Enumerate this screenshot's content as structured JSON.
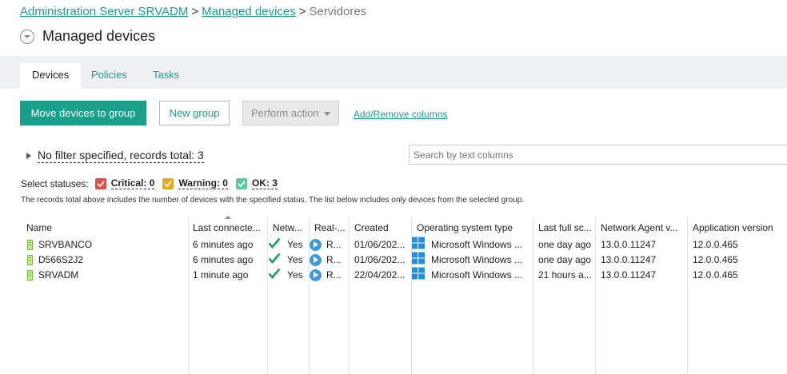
{
  "breadcrumb": {
    "server": "Administration Server SRVADM",
    "managed": "Managed devices",
    "current": "Servidores",
    "sep": ">"
  },
  "page": {
    "title": "Managed devices"
  },
  "tabs": [
    {
      "label": "Devices",
      "active": true
    },
    {
      "label": "Policies",
      "active": false
    },
    {
      "label": "Tasks",
      "active": false
    }
  ],
  "toolbar": {
    "move_label": "Move devices to group",
    "new_group_label": "New group",
    "perform_action_label": "Perform action",
    "add_remove_label": "Add/Remove columns"
  },
  "filter": {
    "text": "No filter specified, records total: 3"
  },
  "search": {
    "placeholder": "Search by text columns"
  },
  "statuses": {
    "label": "Select statuses:",
    "critical": "Critical: 0",
    "warning": "Warning: 0",
    "ok": "OK: 3"
  },
  "note": "The records total above includes the number of devices with the specified status. The list below includes only devices from the selected group.",
  "table": {
    "columns": [
      "Name",
      "Last connecte...",
      "Netw...",
      "Real-...",
      "Created",
      "Operating system type",
      "Last full sc...",
      "Network Agent v...",
      "Application version"
    ],
    "rows": [
      {
        "name": "SRVBANCO",
        "last_connected": "6 minutes ago",
        "network": "Yes",
        "realtime": "R...",
        "created": "01/06/202...",
        "os": "Microsoft Windows ...",
        "last_scan": "one day ago",
        "agent": "13.0.0.11247",
        "app": "12.0.0.465"
      },
      {
        "name": "D566S2J2",
        "last_connected": "6 minutes ago",
        "network": "Yes",
        "realtime": "R...",
        "created": "01/06/202...",
        "os": "Microsoft Windows ...",
        "last_scan": "one day ago",
        "agent": "13.0.0.11247",
        "app": "12.0.0.465"
      },
      {
        "name": "SRVADM",
        "last_connected": "1 minute ago",
        "network": "Yes",
        "realtime": "R...",
        "created": "22/04/202...",
        "os": "Microsoft Windows ...",
        "last_scan": "21 hours a...",
        "agent": "13.0.0.11247",
        "app": "12.0.0.465"
      }
    ]
  },
  "colors": {
    "accent": "#1b9e8a",
    "critical": "#e0504a",
    "warning": "#e8a723",
    "ok": "#5dc8a0",
    "windows": "#1e90e0",
    "checkmark": "#1e9e5a"
  },
  "icons": {
    "collapse": "chevron-down-circle-icon",
    "device": "device-icon",
    "network": "check-icon",
    "realtime": "play-icon",
    "os": "windows-icon"
  }
}
